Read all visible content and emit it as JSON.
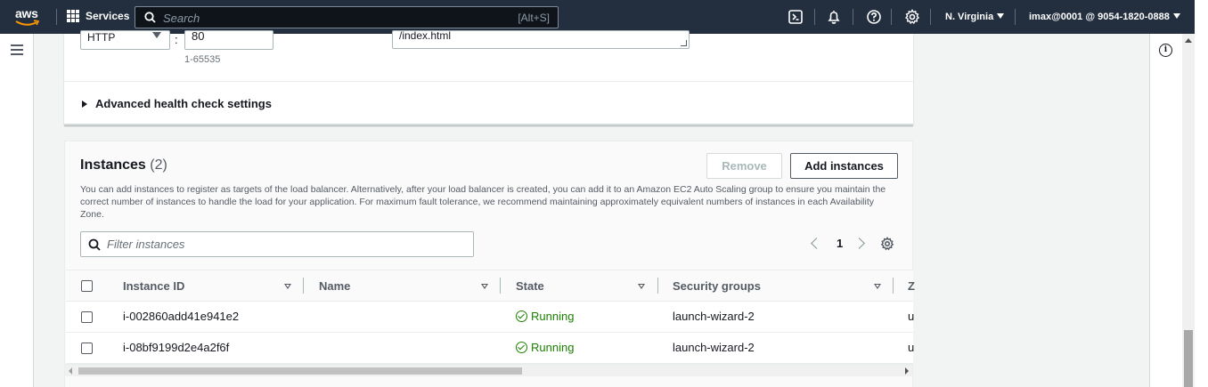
{
  "topnav": {
    "logo": "aws",
    "services_label": "Services",
    "search_placeholder": "Search",
    "search_shortcut": "[Alt+S]",
    "icons": [
      "cloudshell-icon",
      "bell-icon",
      "help-icon",
      "gear-icon"
    ],
    "region": "N. Virginia",
    "account": "imax@0001 @ 9054-1820-0888"
  },
  "health_check": {
    "protocol": "HTTP",
    "port": "80",
    "port_hint": "1-65535",
    "path": "/index.html",
    "advanced_label": "Advanced health check settings"
  },
  "instances": {
    "title": "Instances",
    "count": "(2)",
    "remove_label": "Remove",
    "add_label": "Add instances",
    "description": "You can add instances to register as targets of the load balancer. Alternatively, after your load balancer is created, you can add it to an Amazon EC2 Auto Scaling group to ensure you maintain the correct number of instances to handle the load for your application. For maximum fault tolerance, we recommend maintaining approximately equivalent numbers of instances in each Availability Zone.",
    "filter_placeholder": "Filter instances",
    "page": "1",
    "columns": [
      "Instance ID",
      "Name",
      "State",
      "Security groups",
      "Z"
    ],
    "rows": [
      {
        "id": "i-002860add41e941e2",
        "name": "",
        "state": "Running",
        "sg": "launch-wizard-2",
        "zone": "u"
      },
      {
        "id": "i-08bf9199d2e4a2f6f",
        "name": "",
        "state": "Running",
        "sg": "launch-wizard-2",
        "zone": "u"
      }
    ]
  },
  "colors": {
    "nav_bg": "#232f3e",
    "running_green": "#1d8102",
    "page_bg": "#f2f3f3"
  }
}
